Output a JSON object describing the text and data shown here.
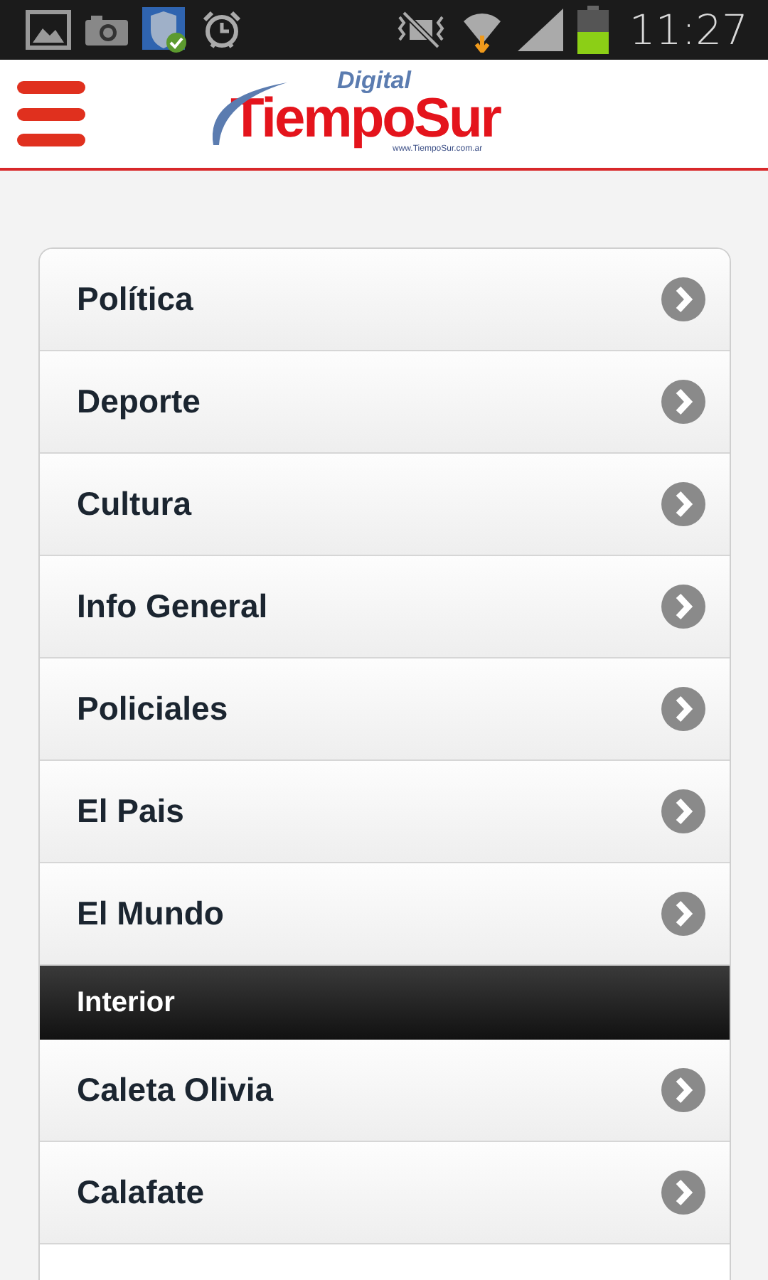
{
  "status_bar": {
    "time": "11:27",
    "battery": {
      "level": 0.5
    }
  },
  "header": {
    "logo": {
      "top": "Digital",
      "main": "TiempoSur",
      "url": "www.TiempoSur.com.ar"
    }
  },
  "menu": [
    {
      "kind": "link",
      "label": "Política"
    },
    {
      "kind": "link",
      "label": "Deporte"
    },
    {
      "kind": "link",
      "label": "Cultura"
    },
    {
      "kind": "link",
      "label": "Info General"
    },
    {
      "kind": "link",
      "label": "Policiales"
    },
    {
      "kind": "link",
      "label": "El Pais"
    },
    {
      "kind": "link",
      "label": "El Mundo"
    },
    {
      "kind": "divider",
      "label": "Interior"
    },
    {
      "kind": "link",
      "label": "Caleta Olivia"
    },
    {
      "kind": "link",
      "label": "Calafate"
    }
  ]
}
